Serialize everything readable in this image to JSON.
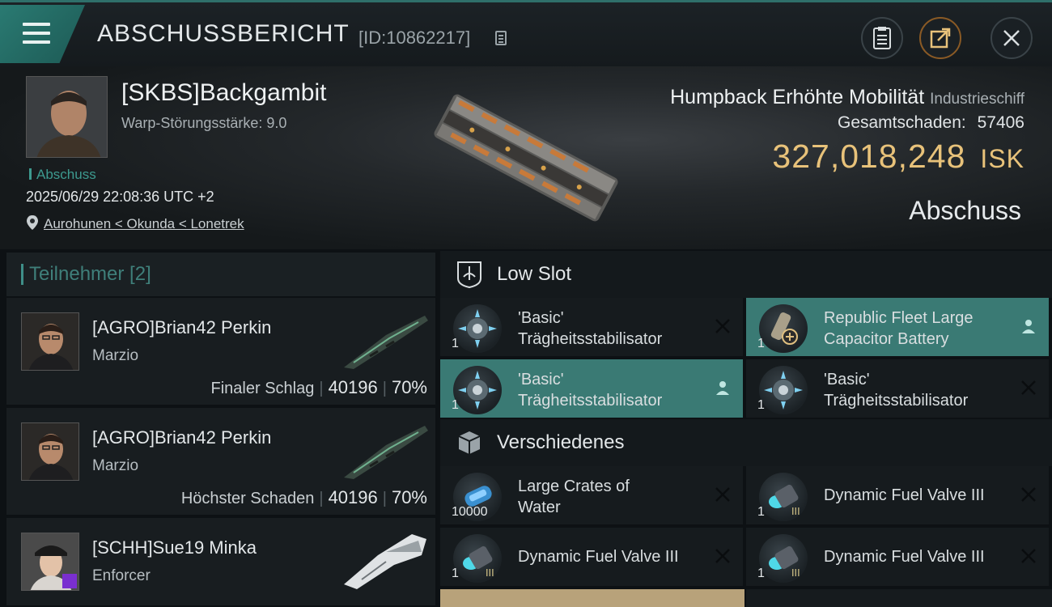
{
  "header": {
    "title": "ABSCHUSSBERICHT",
    "id_label": "[ID:10862217]"
  },
  "victim": {
    "name": "[SKBS]Backgambit",
    "warp_strength": "Warp-Störungsstärke: 9.0",
    "kill_tag": "Abschuss",
    "datetime": "2025/06/29 22:08:36 UTC +2",
    "location": "Aurohunen < Okunda < Lonetrek"
  },
  "ship": {
    "name": "Humpback Erhöhte Mobilität",
    "class": "Industrieschiff",
    "damage_label": "Gesamtschaden:",
    "damage_value": "57406",
    "isk_value": "327,018,248",
    "isk_unit": "ISK",
    "result": "Abschuss"
  },
  "participants": {
    "title": "Teilnehmer [2]",
    "rows": [
      {
        "name": "[AGRO]Brian42 Perkin",
        "ship": "Marzio",
        "role": "Finaler Schlag",
        "damage": "40196",
        "percent": "70%"
      },
      {
        "name": "[AGRO]Brian42 Perkin",
        "ship": "Marzio",
        "role": "Höchster Schaden",
        "damage": "40196",
        "percent": "70%"
      },
      {
        "name": "[SCHH]Sue19 Minka",
        "ship": "Enforcer",
        "role": "",
        "damage": "",
        "percent": ""
      }
    ]
  },
  "sections": {
    "low_slot": "Low Slot",
    "misc": "Verschiedenes"
  },
  "low_slot_items": [
    {
      "line1": "'Basic'",
      "line2": "Trägheitsstabilisator",
      "qty": "1",
      "status": "destroyed"
    },
    {
      "line1": "Republic Fleet Large",
      "line2": "Capacitor Battery",
      "qty": "1",
      "status": "dropped"
    },
    {
      "line1": "'Basic'",
      "line2": "Trägheitsstabilisator",
      "qty": "1",
      "status": "dropped"
    },
    {
      "line1": "'Basic'",
      "line2": "Trägheitsstabilisator",
      "qty": "1",
      "status": "destroyed"
    }
  ],
  "misc_items": [
    {
      "line1": "Large Crates of",
      "line2": "Water",
      "qty": "10000",
      "status": "destroyed"
    },
    {
      "line1": "Dynamic Fuel Valve III",
      "line2": "",
      "qty": "1",
      "status": "destroyed"
    },
    {
      "line1": "Dynamic Fuel Valve III",
      "line2": "",
      "qty": "1",
      "status": "destroyed"
    },
    {
      "line1": "Dynamic Fuel Valve III",
      "line2": "",
      "qty": "1",
      "status": "destroyed"
    }
  ],
  "colors": {
    "accent": "#3a7a74",
    "isk": "#e8c27a"
  }
}
